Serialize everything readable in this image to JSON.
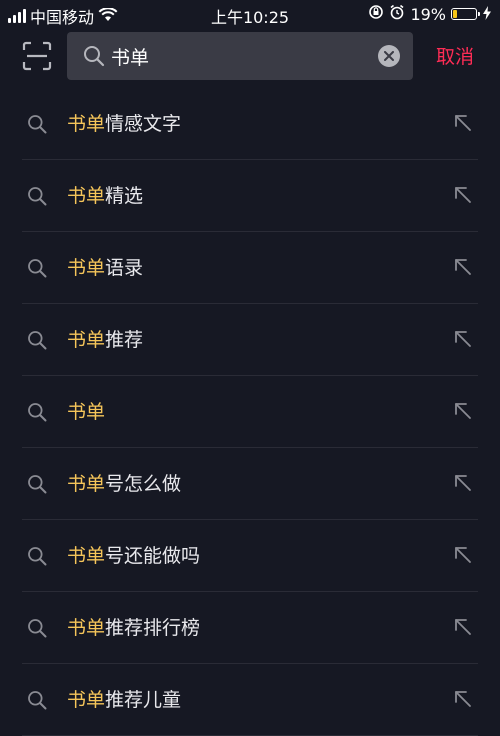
{
  "status_bar": {
    "carrier": "中国移动",
    "time": "上午10:25",
    "battery_percent": "19%",
    "battery_level": 0.19,
    "battery_fill_color": "#f5c518",
    "icons": [
      "signal-icon",
      "wifi-icon",
      "rotation-lock-icon",
      "alarm-icon",
      "battery-icon",
      "charging-bolt-icon"
    ]
  },
  "search": {
    "query": "书单",
    "cancel_label": "取消",
    "accent_color": "#fe2c55"
  },
  "suggestions": [
    {
      "highlight": "书单",
      "rest": "情感文字"
    },
    {
      "highlight": "书单",
      "rest": "精选"
    },
    {
      "highlight": "书单",
      "rest": "语录"
    },
    {
      "highlight": "书单",
      "rest": "推荐"
    },
    {
      "highlight": "书单",
      "rest": ""
    },
    {
      "highlight": "书单",
      "rest": "号怎么做"
    },
    {
      "highlight": "书单",
      "rest": "号还能做吗"
    },
    {
      "highlight": "书单",
      "rest": "推荐排行榜"
    },
    {
      "highlight": "书单",
      "rest": "推荐儿童"
    }
  ],
  "highlight_color": "#f5c55a"
}
